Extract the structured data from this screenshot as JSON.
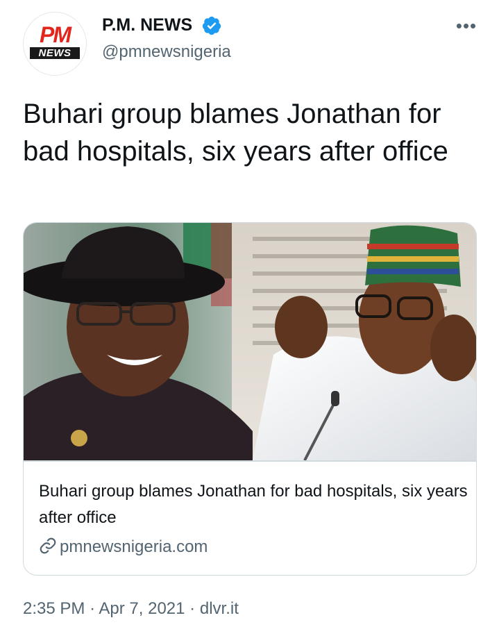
{
  "account": {
    "display_name": "P.M. NEWS",
    "handle": "@pmnewsnigeria",
    "avatar_line1": "PM",
    "avatar_line2": "NEWS",
    "verified": true,
    "more_label": "•••"
  },
  "tweet": {
    "text": "Buhari group blames Jonathan for bad hospitals, six years after office"
  },
  "card": {
    "title": "Buhari group blames Jonathan for bad hospitals, six years after office",
    "domain": "pmnewsnigeria.com"
  },
  "meta": {
    "time": "2:35 PM",
    "separator": "·",
    "date": "Apr 7, 2021",
    "source": "dlvr.it"
  },
  "colors": {
    "verified_blue": "#1d9bf0",
    "secondary_text": "#536471",
    "border": "#cfd9de",
    "brand_red": "#e2261c"
  }
}
